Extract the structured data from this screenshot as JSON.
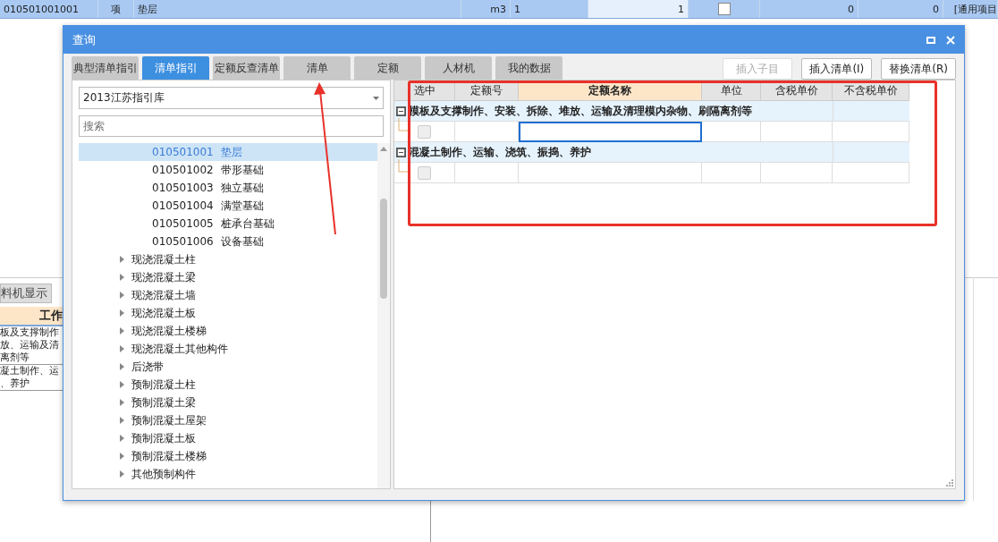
{
  "background": {
    "row": {
      "code": "010501001001",
      "type": "项",
      "name": "垫层",
      "unit": "m3",
      "quantity": "1",
      "amount": "1",
      "checked": false,
      "value_1": "0",
      "value_2": "0",
      "note": "[通用项目"
    },
    "lower_panel": {
      "tab": "料机显示",
      "header": "工作",
      "rows": [
        {
          "lines": [
            "板及支撑制作",
            "放、运输及清",
            "离剂等"
          ]
        },
        {
          "lines": [
            "凝土制作、运",
            "、养护"
          ]
        }
      ]
    }
  },
  "dialog": {
    "title": "查询",
    "tabs": [
      {
        "label": "典型清单指引",
        "selected": false
      },
      {
        "label": "清单指引",
        "selected": true
      },
      {
        "label": "定额反查清单",
        "selected": false
      },
      {
        "label": "清单",
        "selected": false
      },
      {
        "label": "定额",
        "selected": false
      },
      {
        "label": "人材机",
        "selected": false
      },
      {
        "label": "我的数据",
        "selected": false
      }
    ],
    "buttons": [
      {
        "label": "插入子目",
        "disabled": true
      },
      {
        "label": "插入清单(I)",
        "disabled": false
      },
      {
        "label": "替换清单(R)",
        "disabled": false
      }
    ],
    "library_select": {
      "value": "2013江苏指引库"
    },
    "search": {
      "placeholder": "搜索"
    },
    "tree": [
      {
        "kind": "leaf",
        "code": "010501001",
        "name": "垫层",
        "selected": true
      },
      {
        "kind": "leaf",
        "code": "010501002",
        "name": "带形基础",
        "selected": false
      },
      {
        "kind": "leaf",
        "code": "010501003",
        "name": "独立基础",
        "selected": false
      },
      {
        "kind": "leaf",
        "code": "010501004",
        "name": "满堂基础",
        "selected": false
      },
      {
        "kind": "leaf",
        "code": "010501005",
        "name": "桩承台基础",
        "selected": false
      },
      {
        "kind": "leaf",
        "code": "010501006",
        "name": "设备基础",
        "selected": false
      },
      {
        "kind": "group",
        "name": "现浇混凝土柱",
        "selected": false
      },
      {
        "kind": "group",
        "name": "现浇混凝土梁",
        "selected": false
      },
      {
        "kind": "group",
        "name": "现浇混凝土墙",
        "selected": false
      },
      {
        "kind": "group",
        "name": "现浇混凝土板",
        "selected": false
      },
      {
        "kind": "group",
        "name": "现浇混凝土楼梯",
        "selected": false
      },
      {
        "kind": "group",
        "name": "现浇混凝土其他构件",
        "selected": false
      },
      {
        "kind": "group",
        "name": "后浇带",
        "selected": false
      },
      {
        "kind": "group",
        "name": "预制混凝土柱",
        "selected": false
      },
      {
        "kind": "group",
        "name": "预制混凝土梁",
        "selected": false
      },
      {
        "kind": "group",
        "name": "预制混凝土屋架",
        "selected": false
      },
      {
        "kind": "group",
        "name": "预制混凝土板",
        "selected": false
      },
      {
        "kind": "group",
        "name": "预制混凝土楼梯",
        "selected": false
      },
      {
        "kind": "group",
        "name": "其他预制构件",
        "selected": false
      }
    ],
    "table": {
      "columns": [
        {
          "label": "选中",
          "highlighted": false
        },
        {
          "label": "定额号",
          "highlighted": false
        },
        {
          "label": "定额名称",
          "highlighted": true
        },
        {
          "label": "单位",
          "highlighted": false
        },
        {
          "label": "含税单价",
          "highlighted": false
        },
        {
          "label": "不含税单价",
          "highlighted": false
        }
      ],
      "groups": [
        {
          "title": "模板及支撑制作、安装、拆除、堆放、运输及清理模内杂物、刷隔离剂等",
          "expanded": true,
          "rows": [
            {
              "checked": false,
              "editing": true
            }
          ]
        },
        {
          "title": "混凝土制作、运输、浇筑、振捣、养护",
          "expanded": true,
          "rows": [
            {
              "checked": false,
              "editing": false
            }
          ]
        }
      ]
    }
  }
}
